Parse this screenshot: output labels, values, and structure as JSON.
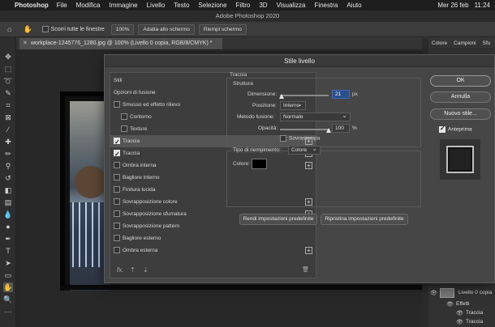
{
  "menubar": {
    "apple": "",
    "app": "Photoshop",
    "items": [
      "File",
      "Modifica",
      "Immagine",
      "Livello",
      "Testo",
      "Selezione",
      "Filtro",
      "3D",
      "Visualizza",
      "Finestra",
      "Aiuto"
    ],
    "date": "Mer 26 feb",
    "time": "11:24"
  },
  "window": {
    "title": "Adobe Photoshop 2020"
  },
  "options": {
    "scroll_all": "Scorri tutte le finestre",
    "zoom": "100%",
    "fit_screen": "Adatta allo schermo",
    "fill_screen": "Riempi schermo"
  },
  "document": {
    "tab": "workplace-1245776_1280.jpg @ 100% (Livello 0 copia, RGB/8/CMYK) *"
  },
  "right_panel": {
    "tabs": [
      "Colore",
      "Campioni",
      "Sfu"
    ],
    "layer_name": "Livello 0 copia",
    "effects": "Effetti",
    "effect_items": [
      "Traccia",
      "Traccia"
    ]
  },
  "dialog": {
    "title": "Stile livello",
    "styles": [
      {
        "label": "Stili",
        "check": false,
        "plus": false,
        "indent": 0,
        "hascheck": false
      },
      {
        "label": "Opzioni di fusione",
        "check": false,
        "plus": false,
        "indent": 0,
        "hascheck": false
      },
      {
        "label": "Smusso ed effetto rilievo",
        "check": false,
        "plus": false,
        "indent": 0,
        "hascheck": true
      },
      {
        "label": "Contorno",
        "check": false,
        "plus": false,
        "indent": 1,
        "hascheck": true
      },
      {
        "label": "Texture",
        "check": false,
        "plus": false,
        "indent": 1,
        "hascheck": true
      },
      {
        "label": "Traccia",
        "check": true,
        "plus": true,
        "indent": 0,
        "hascheck": true,
        "selected": true
      },
      {
        "label": "Traccia",
        "check": true,
        "plus": true,
        "indent": 0,
        "hascheck": true
      },
      {
        "label": "Ombra interna",
        "check": false,
        "plus": true,
        "indent": 0,
        "hascheck": true
      },
      {
        "label": "Bagliore interno",
        "check": false,
        "plus": false,
        "indent": 0,
        "hascheck": true
      },
      {
        "label": "Finitura lucida",
        "check": false,
        "plus": false,
        "indent": 0,
        "hascheck": true
      },
      {
        "label": "Sovrapposizione colore",
        "check": false,
        "plus": true,
        "indent": 0,
        "hascheck": true
      },
      {
        "label": "Sovrapposizione sfumatura",
        "check": false,
        "plus": true,
        "indent": 0,
        "hascheck": true
      },
      {
        "label": "Sovrapposizione pattern",
        "check": false,
        "plus": false,
        "indent": 0,
        "hascheck": true
      },
      {
        "label": "Bagliore esterno",
        "check": false,
        "plus": false,
        "indent": 0,
        "hascheck": true
      },
      {
        "label": "Ombra esterna",
        "check": false,
        "plus": true,
        "indent": 0,
        "hascheck": true
      }
    ],
    "footer": {
      "fx": "fx.",
      "up": "⇡",
      "down": "⇣",
      "trash": "🗑"
    },
    "stroke": {
      "section": "Traccia",
      "structure": "Struttura",
      "size_label": "Dimensione:",
      "size_value": "21",
      "size_unit": "px",
      "position_label": "Posizione:",
      "position_value": "Interno",
      "blend_label": "Metodo fusione:",
      "blend_value": "Normale",
      "opacity_label": "Opacità:",
      "opacity_value": "100",
      "opacity_unit": "%",
      "overprint": "Sovrastampa",
      "fill_type_label": "Tipo di riempimento:",
      "fill_type_value": "Colore",
      "color_label": "Colore:",
      "color": "#000000",
      "make_default": "Rendi impostazioni predefinite",
      "reset_default": "Ripristina impostazioni predefinite",
      "size_fraction": 0.04,
      "opacity_fraction": 1.0
    },
    "buttons": {
      "ok": "OK",
      "cancel": "Annulla",
      "new_style": "Nuovo stile...",
      "preview": "Anteprima"
    }
  }
}
